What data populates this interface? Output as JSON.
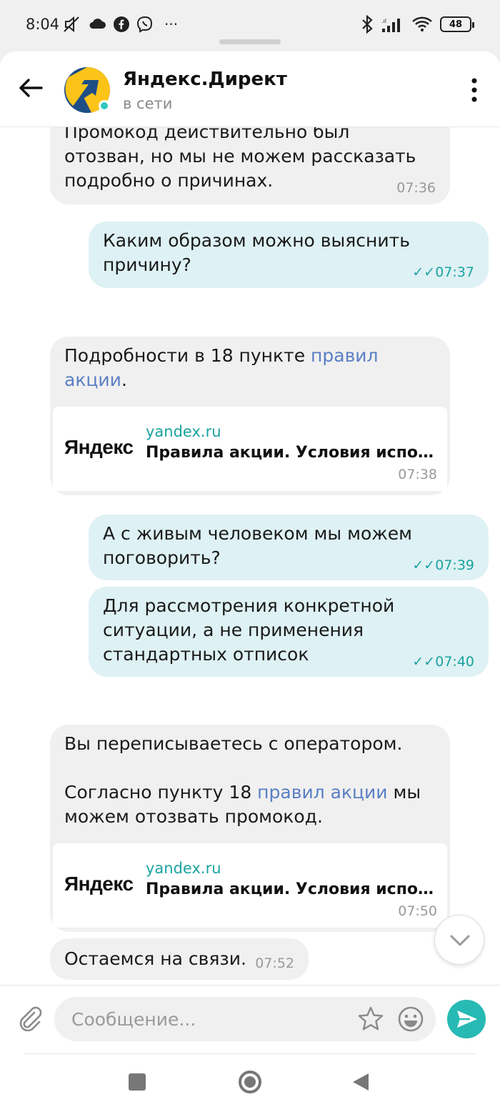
{
  "status_bar": {
    "time": "8:04",
    "more": "···",
    "battery": "48"
  },
  "header": {
    "title": "Яндекс.Директ",
    "status": "в сети"
  },
  "messages": [
    {
      "dir": "in",
      "lines": [
        "Промокод действительно был",
        "отозван, но мы не можем рассказать",
        "подробно о причинах."
      ],
      "time": "07:36"
    },
    {
      "dir": "out",
      "lines": [
        "Каким образом можно выяснить",
        "причину?"
      ],
      "time": "07:37"
    },
    {
      "dir": "in",
      "text_before": "Подробности в 18 пункте ",
      "link": "правил",
      "line2_link": "акции",
      "line2_after": ".",
      "time": "07:38",
      "preview": {
        "logo": "Яндекс",
        "domain": "yandex.ru",
        "title": "Правила акции. Условия использ..."
      }
    },
    {
      "dir": "out",
      "lines": [
        "А с живым человеком мы можем",
        "поговорить?"
      ],
      "time": "07:39"
    },
    {
      "dir": "out",
      "lines": [
        "Для рассмотрения конкретной",
        "ситуации, а не применения",
        "стандартных отписок"
      ],
      "time": "07:40"
    },
    {
      "dir": "in",
      "line1": "Вы переписываетесь с оператором.",
      "line3_before": "Согласно пункту 18 ",
      "line3_link": "правил акции",
      "line3_after": " мы",
      "line4": "можем отозвать промокод.",
      "time": "07:50",
      "preview": {
        "logo": "Яндекс",
        "domain": "yandex.ru",
        "title": "Правила акции. Условия использ..."
      }
    },
    {
      "dir": "in",
      "text": "Остаемся на связи.",
      "time": "07:52"
    }
  ],
  "composer": {
    "placeholder": "Сообщение..."
  },
  "colors": {
    "accent": "#27b9b3",
    "outgoing_bubble": "#def1f4",
    "incoming_bubble": "#f0f0f0",
    "link": "#5a7fc4"
  },
  "icons": [
    "back-arrow-icon",
    "more-vert-icon",
    "attach-icon",
    "star-icon",
    "emoji-icon",
    "send-icon",
    "chevron-down-icon"
  ]
}
